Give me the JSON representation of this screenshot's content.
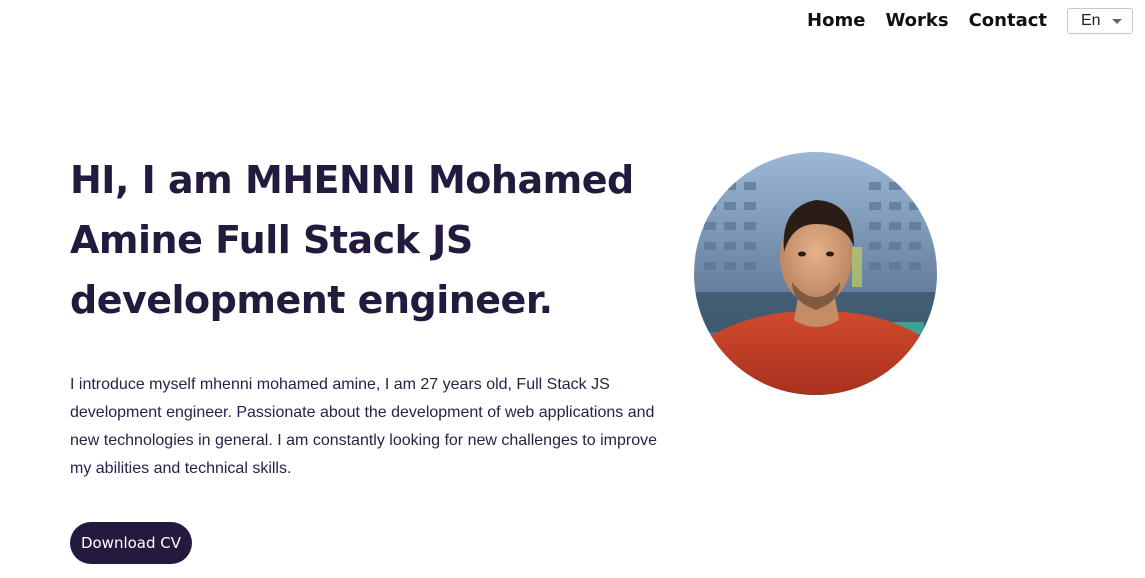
{
  "nav": {
    "links": [
      "Home",
      "Works",
      "Contact"
    ],
    "language": "En"
  },
  "hero": {
    "title": "HI, I am MHENNI Mohamed Amine Full Stack JS development engineer.",
    "description": "I introduce myself mhenni mohamed amine, I am 27 years old, Full Stack JS development engineer. Passionate about the development of web applications and new technologies in general. I am constantly looking for new challenges to improve my abilities and technical skills.",
    "cv_button": "Download CV"
  },
  "colors": {
    "primary": "#231a3d",
    "background": "#ffffff"
  },
  "icons": {
    "language_dropdown": "chevron-down-icon"
  }
}
